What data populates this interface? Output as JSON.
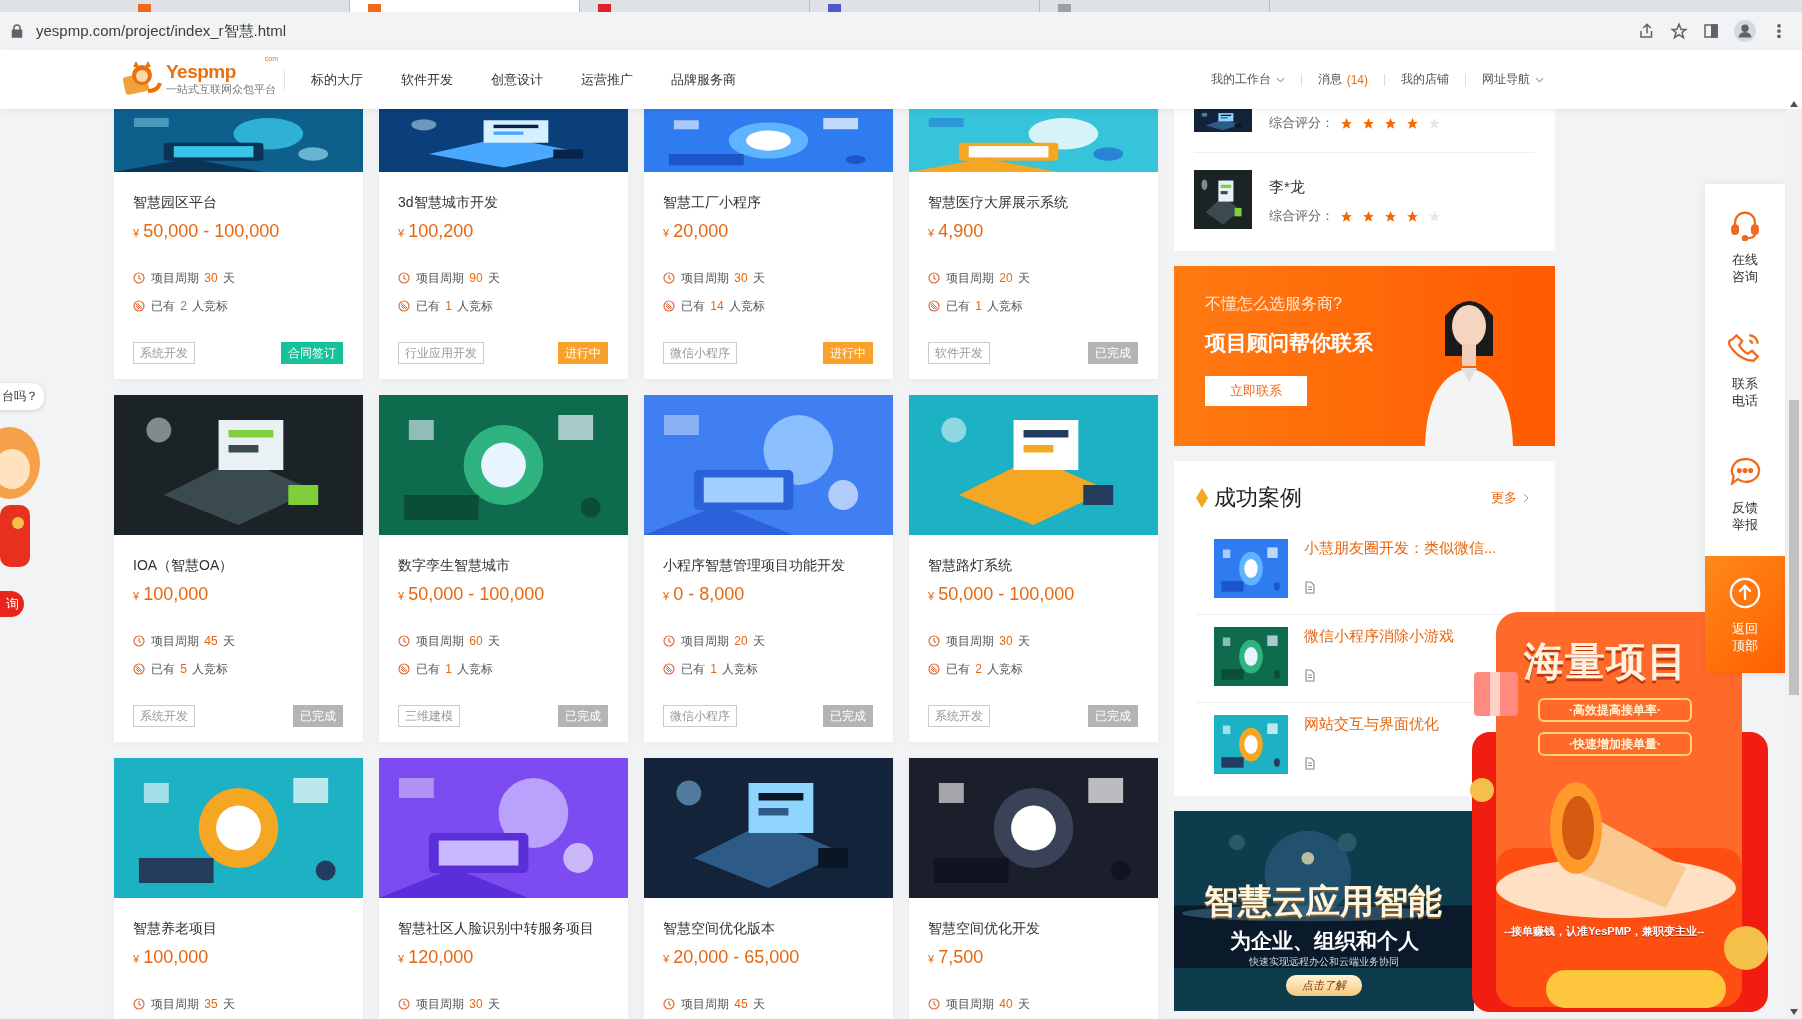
{
  "browser": {
    "url": "yespmp.com/project/index_r智慧.html"
  },
  "site_header": {
    "logo": {
      "name": "Yespmp",
      "domain": "com",
      "tagline": "一站式互联网众包平台"
    },
    "nav": [
      "标的大厅",
      "软件开发",
      "创意设计",
      "运营推广",
      "品牌服务商"
    ],
    "user_nav": [
      {
        "label": "我的工作台",
        "dropdown": true
      },
      {
        "label": "消息",
        "count": "(14)",
        "dropdown": false
      },
      {
        "label": "我的店铺",
        "dropdown": false
      },
      {
        "label": "网址导航",
        "dropdown": true
      }
    ]
  },
  "cards": [
    {
      "title": "智慧园区平台",
      "currency": "¥",
      "price": "50,000 - 100,000",
      "duration": {
        "label": "项目周期",
        "value": "30",
        "unit": "天"
      },
      "bids": {
        "label": "已有",
        "value": "2",
        "unit": "人竞标"
      },
      "tag": "系统开发",
      "status": {
        "text": "合同签订",
        "kind": "contract"
      }
    },
    {
      "title": "3d智慧城市开发",
      "currency": "¥",
      "price": "100,200",
      "duration": {
        "label": "项目周期",
        "value": "90",
        "unit": "天"
      },
      "bids": {
        "label": "已有",
        "value": "1",
        "unit": "人竞标"
      },
      "tag": "行业应用开发",
      "status": {
        "text": "进行中",
        "kind": "ongoing"
      }
    },
    {
      "title": "智慧工厂小程序",
      "currency": "¥",
      "price": "20,000",
      "duration": {
        "label": "项目周期",
        "value": "30",
        "unit": "天"
      },
      "bids": {
        "label": "已有",
        "value": "14",
        "unit": "人竞标"
      },
      "tag": "微信小程序",
      "status": {
        "text": "进行中",
        "kind": "ongoing"
      }
    },
    {
      "title": "智慧医疗大屏展示系统",
      "currency": "¥",
      "price": "4,900",
      "duration": {
        "label": "项目周期",
        "value": "20",
        "unit": "天"
      },
      "bids": {
        "label": "已有",
        "value": "1",
        "unit": "人竞标"
      },
      "tag": "软件开发",
      "status": {
        "text": "已完成",
        "kind": "done"
      }
    },
    {
      "title": "IOA（智慧OA）",
      "currency": "¥",
      "price": "100,000",
      "duration": {
        "label": "项目周期",
        "value": "45",
        "unit": "天"
      },
      "bids": {
        "label": "已有",
        "value": "5",
        "unit": "人竞标"
      },
      "tag": "系统开发",
      "status": {
        "text": "已完成",
        "kind": "done"
      }
    },
    {
      "title": "数字孪生智慧城市",
      "currency": "¥",
      "price": "50,000 - 100,000",
      "duration": {
        "label": "项目周期",
        "value": "60",
        "unit": "天"
      },
      "bids": {
        "label": "已有",
        "value": "1",
        "unit": "人竞标"
      },
      "tag": "三维建模",
      "status": {
        "text": "已完成",
        "kind": "done"
      }
    },
    {
      "title": "小程序智慧管理项目功能开发",
      "currency": "¥",
      "price": "0 - 8,000",
      "duration": {
        "label": "项目周期",
        "value": "20",
        "unit": "天"
      },
      "bids": {
        "label": "已有",
        "value": "1",
        "unit": "人竞标"
      },
      "tag": "微信小程序",
      "status": {
        "text": "已完成",
        "kind": "done"
      }
    },
    {
      "title": "智慧路灯系统",
      "currency": "¥",
      "price": "50,000 - 100,000",
      "duration": {
        "label": "项目周期",
        "value": "30",
        "unit": "天"
      },
      "bids": {
        "label": "已有",
        "value": "2",
        "unit": "人竞标"
      },
      "tag": "系统开发",
      "status": {
        "text": "已完成",
        "kind": "done"
      }
    },
    {
      "title": "智慧养老项目",
      "currency": "¥",
      "price": "100,000",
      "duration": {
        "label": "项目周期",
        "value": "35",
        "unit": "天"
      }
    },
    {
      "title": "智慧社区人脸识别中转服务项目",
      "currency": "¥",
      "price": "120,000",
      "duration": {
        "label": "项目周期",
        "value": "30",
        "unit": "天"
      }
    },
    {
      "title": "智慧空间优化版本",
      "currency": "¥",
      "price": "20,000 - 65,000",
      "duration": {
        "label": "项目周期",
        "value": "45",
        "unit": "天"
      }
    },
    {
      "title": "智慧空间优化开发",
      "currency": "¥",
      "price": "7,500",
      "duration": {
        "label": "项目周期",
        "value": "40",
        "unit": "天"
      }
    }
  ],
  "sidebar": {
    "providers": [
      {
        "rating_label": "综合评分：",
        "stars": 4
      },
      {
        "name": "李*龙",
        "rating_label": "综合评分：",
        "stars": 4
      }
    ],
    "contact_banner": {
      "question": "不懂怎么选服务商?",
      "headline": "项目顾问帮你联系",
      "button": "立即联系"
    },
    "success_cases": {
      "title": "成功案例",
      "more": "更多",
      "items": [
        {
          "title": "小慧朋友圈开发：类似微信..."
        },
        {
          "title": "微信小程序消除小游戏"
        },
        {
          "title": "网站交互与界面优化"
        }
      ]
    },
    "cloud_banner": {
      "headline": "智慧云应用智能",
      "subhead": "为企业、组织和个人",
      "detail": "快速实现远程办公和云端业务协同",
      "button": "点击了解"
    }
  },
  "float_toolbar": [
    {
      "kind": "headset",
      "label": "在线咨询"
    },
    {
      "kind": "phone",
      "label": "联系电话"
    },
    {
      "kind": "chat",
      "label": "反馈举报"
    },
    {
      "kind": "top",
      "label": "返回顶部"
    }
  ],
  "promo_popup": {
    "headline": "海量项目",
    "perks": [
      "·高效提高接单率·",
      "·快速增加接单量·"
    ],
    "slogan": "--接单赚钱，认准YesPMP，兼职变主业--"
  },
  "chat_mascot": {
    "bubble": "台吗？",
    "badge": "询"
  }
}
